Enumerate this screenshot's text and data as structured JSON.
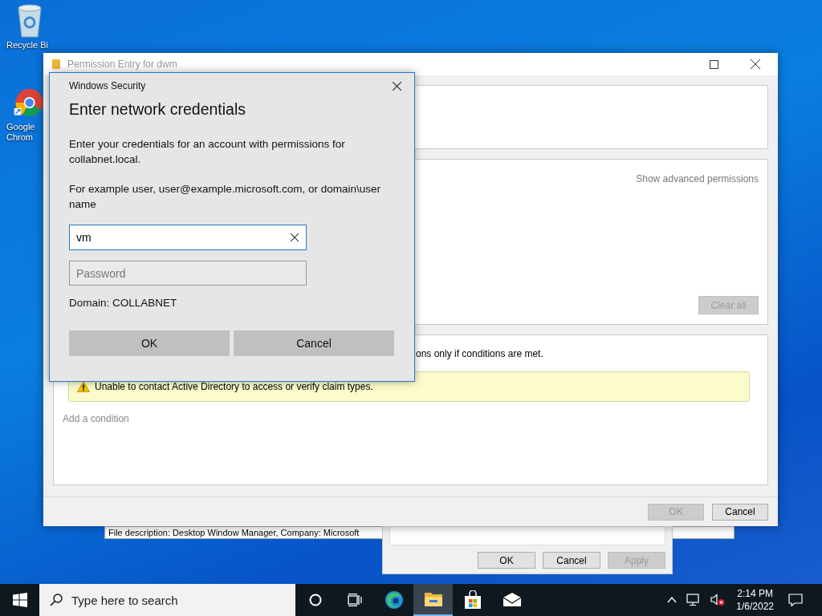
{
  "desktop_icons": [
    {
      "kind": "recycle",
      "lines": [
        "Recycle Bi"
      ]
    },
    {
      "kind": "chrome",
      "lines": [
        "Google",
        "Chrom"
      ]
    }
  ],
  "properties_window": {
    "description": "File description: Desktop Window Manager, Company: Microsoft",
    "buttons": [
      {
        "label": "OK",
        "disabled": false
      },
      {
        "label": "Cancel",
        "disabled": false
      },
      {
        "label": "Apply",
        "disabled": true
      }
    ]
  },
  "permission_window": {
    "title": "Permission Entry for dwm",
    "show_advanced": "Show advanced permissions",
    "clear_all": {
      "label": "Clear all",
      "disabled": true
    },
    "condition_text": "ons only if conditions are met.",
    "warning": "Unable to contact Active Directory to access or verify claim types.",
    "add_condition": "Add a condition",
    "buttons": [
      {
        "label": "OK",
        "disabled": true
      },
      {
        "label": "Cancel",
        "disabled": false
      }
    ]
  },
  "credential_dialog": {
    "title": "Windows Security",
    "heading": "Enter network credentials",
    "description": "Enter your credentials for an account with permissions for collabnet.local.",
    "example": "For example user, user@example.microsoft.com, or domain\\user name",
    "username": "vm",
    "password_placeholder": "Password",
    "domain": "Domain: COLLABNET",
    "buttons": [
      "OK",
      "Cancel"
    ]
  },
  "taskbar": {
    "search_placeholder": "Type here to search",
    "apps": [
      {
        "kind": "cortana",
        "selected": false
      },
      {
        "kind": "taskview",
        "selected": false
      },
      {
        "kind": "edge",
        "selected": false
      },
      {
        "kind": "explorer",
        "selected": true
      },
      {
        "kind": "store",
        "selected": false
      },
      {
        "kind": "mail",
        "selected": false
      }
    ],
    "time": "2:14 PM",
    "date": "1/6/2022"
  }
}
